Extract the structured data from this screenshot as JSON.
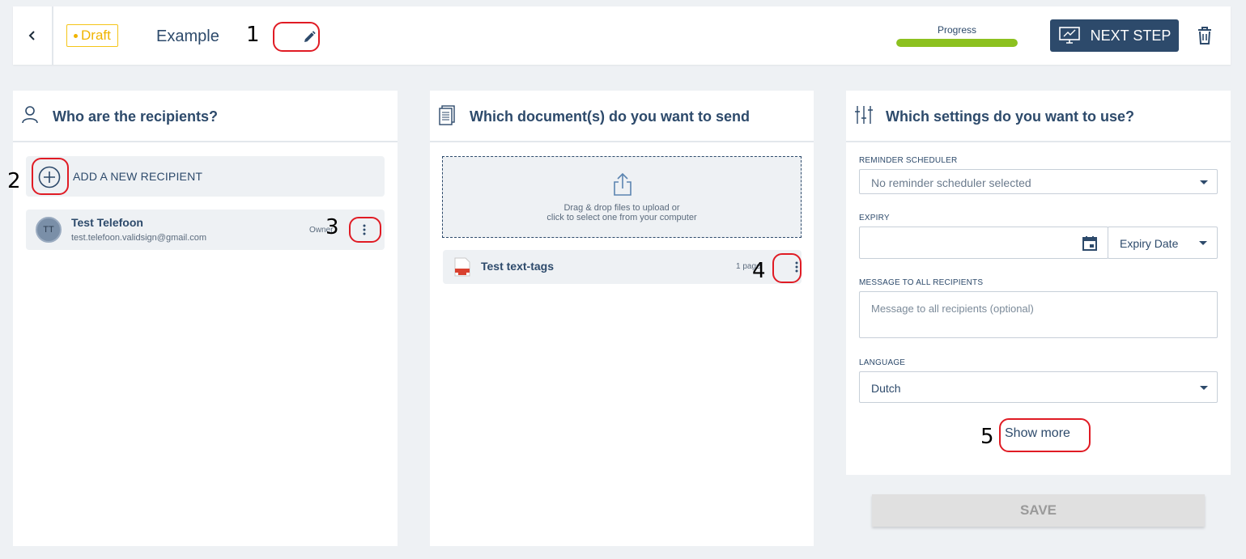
{
  "header": {
    "status_badge": "Draft",
    "title": "Example",
    "progress_label": "Progress",
    "progress_value": 1.0,
    "next_step_label": "NEXT STEP"
  },
  "annotations": [
    "1",
    "2",
    "3",
    "4",
    "5"
  ],
  "recipients_panel": {
    "heading": "Who are the recipients?",
    "add_label": "ADD A NEW RECIPIENT",
    "recipients": [
      {
        "initials": "TT",
        "name": "Test Telefoon",
        "email": "test.telefoon.validsign@gmail.com",
        "role": "Owner"
      }
    ]
  },
  "documents_panel": {
    "heading": "Which document(s) do you want to send",
    "dropzone_line1": "Drag & drop files to upload or",
    "dropzone_line2": "click to select one from your computer",
    "documents": [
      {
        "name": "Test text-tags",
        "pages": "1 page"
      }
    ]
  },
  "settings_panel": {
    "heading": "Which settings do you want to use?",
    "reminder_label": "REMINDER SCHEDULER",
    "reminder_value": "No reminder scheduler selected",
    "expiry_label": "EXPIRY",
    "expiry_type": "Expiry Date",
    "message_label": "MESSAGE TO ALL RECIPIENTS",
    "message_placeholder": "Message to all recipients (optional)",
    "language_label": "LANGUAGE",
    "language_value": "Dutch",
    "show_more": "Show more",
    "save_label": "SAVE"
  },
  "colors": {
    "primary": "#2d4a6b",
    "progress": "#8cc11f",
    "draft": "#f0b400",
    "annotation": "#e01b24"
  }
}
